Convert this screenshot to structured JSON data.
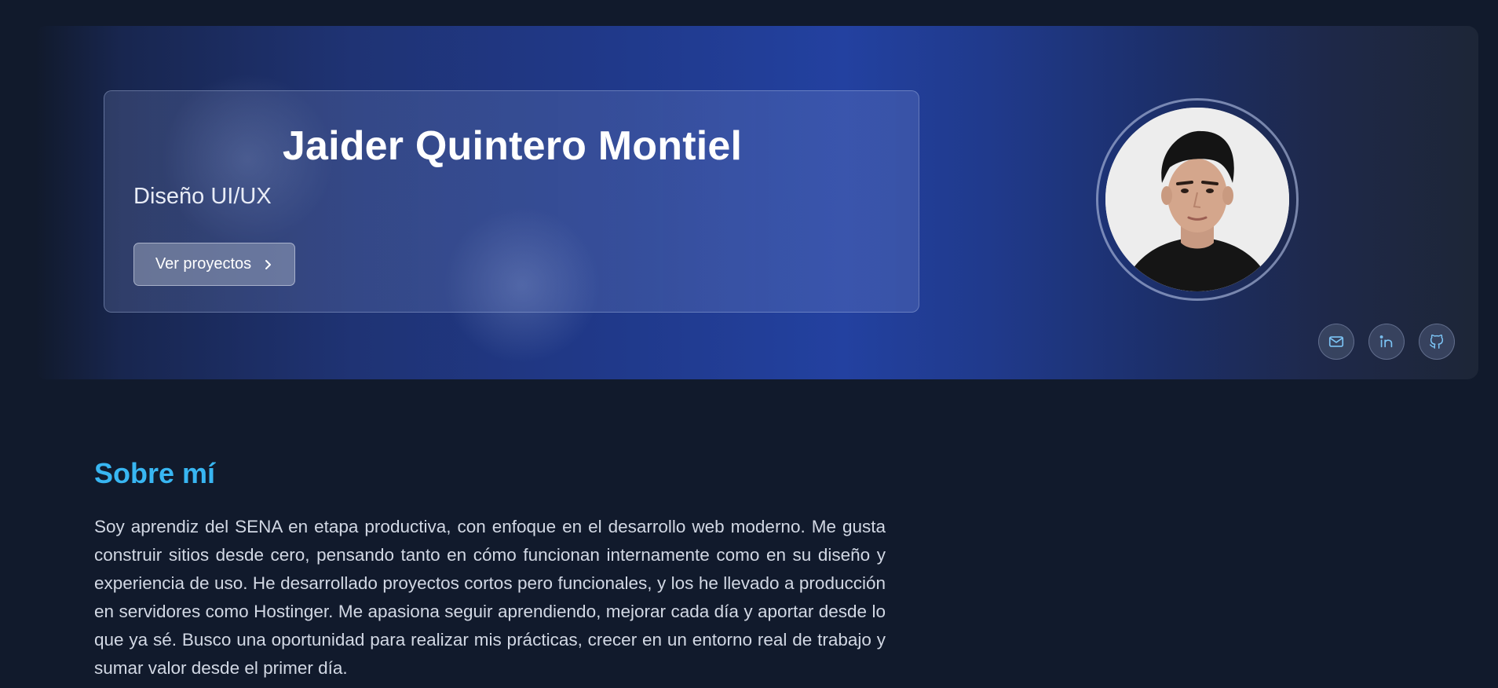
{
  "hero": {
    "name": "Jaider Quintero Montiel",
    "role": "Diseño UI/UX",
    "cta_label": "Ver proyectos",
    "cta_icon": "chevron-right-icon",
    "avatar_alt": "Jaider Quintero Montiel",
    "socials": [
      {
        "name": "email",
        "icon": "mail-icon"
      },
      {
        "name": "linkedin",
        "icon": "linkedin-icon"
      },
      {
        "name": "github",
        "icon": "github-icon"
      }
    ]
  },
  "about": {
    "title": "Sobre mí",
    "text": "Soy aprendiz del SENA en etapa productiva, con enfoque en el desarrollo web moderno. Me gusta construir sitios desde cero, pensando tanto en cómo funcionan internamente como en su diseño y experiencia de uso. He desarrollado proyectos cortos pero funcionales, y los he llevado a producción en servidores como Hostinger. Me apasiona seguir aprendiendo, mejorar cada día y aportar desde lo que ya sé. Busco una oportunidad para realizar mis prácticas, crecer en un entorno real de trabajo y sumar valor desde el primer día."
  },
  "colors": {
    "background": "#111a2c",
    "accent": "#38b6f2",
    "hero_blue": "#2341a0",
    "icon_blue": "#7cc4f5"
  }
}
